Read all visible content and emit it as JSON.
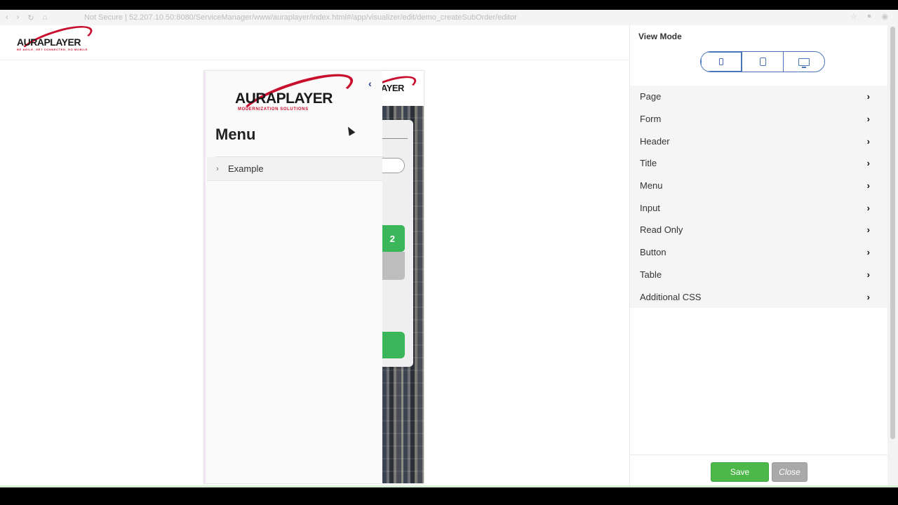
{
  "browser": {
    "url": "Not Secure | 52.207.10.50:8080/ServiceManager/www/auraplayer/index.html#/app/visualizer/edit/demo_createSubOrder/editor"
  },
  "header": {
    "logo_text": "AURAPLAYER",
    "logo_tagline": "BE AGILE, GET CONNECTED, GO MOBILE"
  },
  "preview": {
    "drawer": {
      "logo_text": "AURAPLAYER",
      "logo_tagline": "MODERNIZATION SOLUTIONS",
      "collapse_glyph": "‹",
      "title": "Menu",
      "items": [
        {
          "label": "Example",
          "icon": "chevron-right-icon"
        }
      ]
    },
    "app": {
      "logo_text": "AYER",
      "button_text": "2"
    }
  },
  "panel": {
    "view_mode_label": "View Mode",
    "view_modes": [
      {
        "name": "phone",
        "icon": "phone-icon",
        "active": true
      },
      {
        "name": "tablet",
        "icon": "tablet-icon",
        "active": false
      },
      {
        "name": "desktop",
        "icon": "desktop-icon",
        "active": false
      }
    ],
    "settings": [
      {
        "label": "Page"
      },
      {
        "label": "Form"
      },
      {
        "label": "Header"
      },
      {
        "label": "Title"
      },
      {
        "label": "Menu"
      },
      {
        "label": "Input"
      },
      {
        "label": "Read Only"
      },
      {
        "label": "Button"
      },
      {
        "label": "Table"
      },
      {
        "label": "Additional CSS"
      }
    ],
    "arrow_glyph": "›",
    "save_label": "Save",
    "close_label": "Close"
  },
  "colors": {
    "brand_red": "#c8102e",
    "accent_blue": "#4a74b8",
    "save_green": "#4cb84a",
    "close_grey": "#a9a9a9"
  }
}
